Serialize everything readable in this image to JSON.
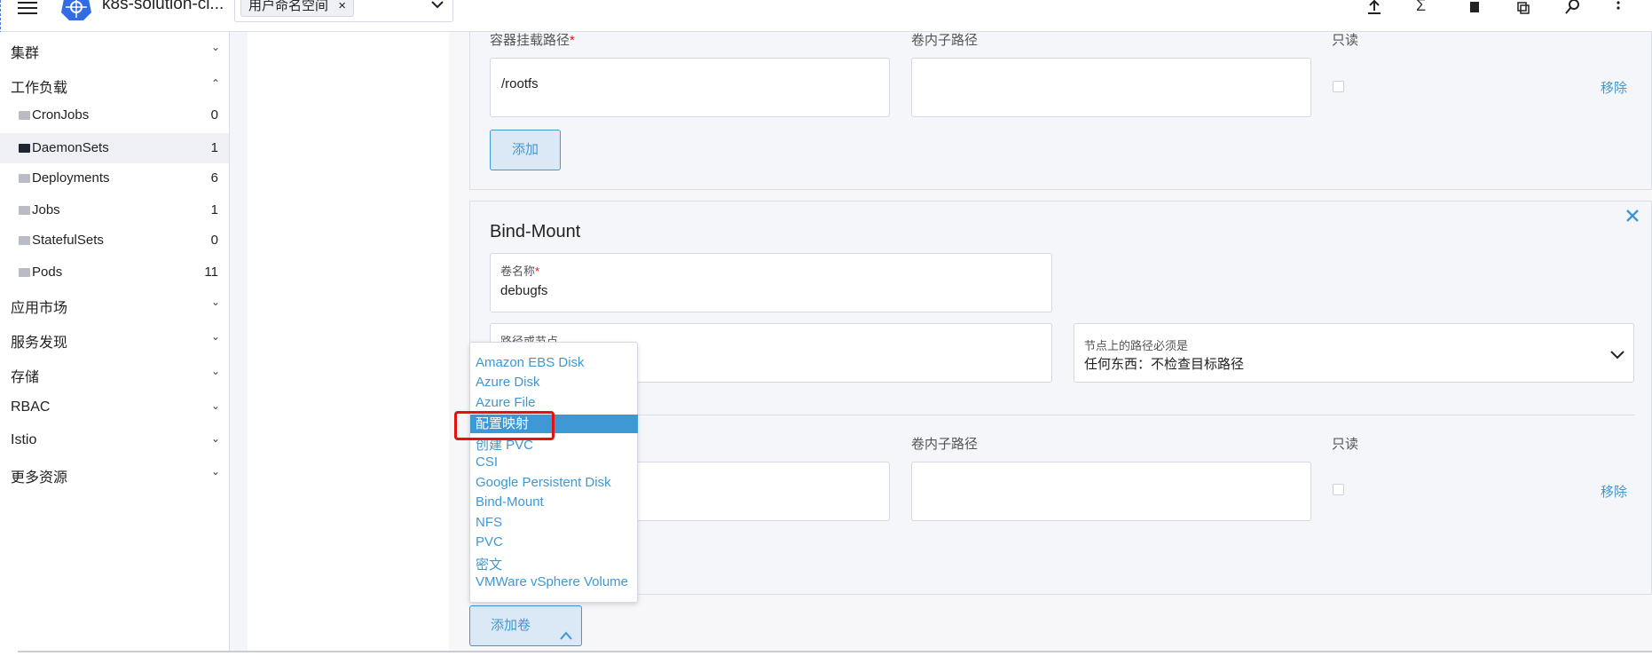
{
  "header": {
    "cluster_name": "k8s-solution-cl...",
    "namespace_chip": "用户命名空间",
    "chip_close": "×",
    "dropdown_chevron": "chevron-down-icon",
    "icons": [
      "hamburger-menu-icon",
      "kubernetes-logo",
      "upload-icon",
      "terminal-icon",
      "file-icon",
      "copy-icon",
      "search-icon",
      "more-vertical-icon"
    ]
  },
  "sidebar": {
    "groups": [
      {
        "label": "集群"
      },
      {
        "label": "工作负载"
      },
      {
        "label": "应用市场"
      },
      {
        "label": "服务发现"
      },
      {
        "label": "存储"
      },
      {
        "label": "RBAC"
      },
      {
        "label": "Istio"
      },
      {
        "label": "更多资源"
      }
    ],
    "workload_items": [
      {
        "label": "CronJobs",
        "count": "0"
      },
      {
        "label": "DaemonSets",
        "count": "1"
      },
      {
        "label": "Deployments",
        "count": "6"
      },
      {
        "label": "Jobs",
        "count": "1"
      },
      {
        "label": "StatefulSets",
        "count": "0"
      },
      {
        "label": "Pods",
        "count": "11"
      }
    ]
  },
  "volume1": {
    "mount_path_label": "容器挂载路径",
    "required_mark": "*",
    "mount_path_value": "/rootfs",
    "sub_path_label": "卷内子路径",
    "readonly_label": "只读",
    "remove_label": "移除",
    "add_label": "添加"
  },
  "bind_mount": {
    "title": "Bind-Mount",
    "close_icon": "close-icon",
    "volume_name_label": "卷名称",
    "required_mark": "*",
    "volume_name_value": "debugfs",
    "host_path_label": "路径或节点",
    "node_path_label": "节点上的路径必须是",
    "node_path_value": "任何东西：不检查目标路径",
    "sub_path_label": "卷内子路径",
    "readonly_label": "只读",
    "remove_label": "移除"
  },
  "add_volume": {
    "label": "添加卷",
    "chevron": "chevron-up-icon"
  },
  "volume_type_menu": {
    "items": [
      "Amazon EBS Disk",
      "Azure Disk",
      "Azure File",
      "配置映射",
      "创建 PVC",
      "CSI",
      "Google Persistent Disk",
      "Bind-Mount",
      "NFS",
      "PVC",
      "密文",
      "VMWare vSphere Volume"
    ],
    "selected": "配置映射"
  }
}
